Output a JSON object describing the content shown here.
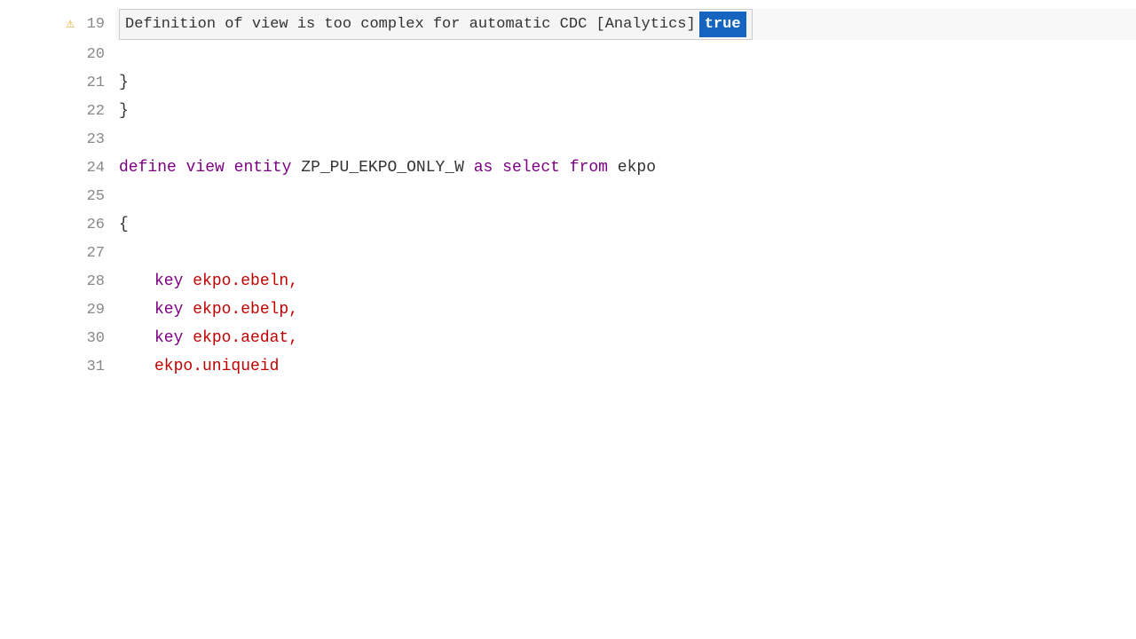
{
  "editor": {
    "lines": [
      {
        "number": "19",
        "hasWarning": true,
        "type": "error-tooltip",
        "tooltip": {
          "message": "Definition of view is too complex for automatic CDC [Analytics]",
          "badge": "true"
        }
      },
      {
        "number": "20",
        "content": ""
      },
      {
        "number": "21",
        "content": "    }"
      },
      {
        "number": "22",
        "content": "  }"
      },
      {
        "number": "23",
        "content": ""
      },
      {
        "number": "24",
        "type": "code",
        "parts": [
          {
            "type": "kw",
            "text": "define"
          },
          {
            "type": "space",
            "text": " "
          },
          {
            "type": "kw",
            "text": "view"
          },
          {
            "type": "space",
            "text": " "
          },
          {
            "type": "kw",
            "text": "entity"
          },
          {
            "type": "space",
            "text": " "
          },
          {
            "type": "plain",
            "text": "ZP_PU_EKPO_ONLY_W "
          },
          {
            "type": "kw",
            "text": "as"
          },
          {
            "type": "space",
            "text": " "
          },
          {
            "type": "kw",
            "text": "select"
          },
          {
            "type": "space",
            "text": " "
          },
          {
            "type": "kw",
            "text": "from"
          },
          {
            "type": "space",
            "text": " "
          },
          {
            "type": "plain",
            "text": "ekpo"
          }
        ]
      },
      {
        "number": "25",
        "content": ""
      },
      {
        "number": "26",
        "content": "    {",
        "type": "brace-line"
      },
      {
        "number": "27",
        "content": ""
      },
      {
        "number": "28",
        "type": "key-line",
        "keyword": "key",
        "field": "ekpo.ebeln,"
      },
      {
        "number": "29",
        "type": "key-line",
        "keyword": "key",
        "field": "ekpo.ebelp,"
      },
      {
        "number": "30",
        "type": "key-line",
        "keyword": "key",
        "field": "ekpo.aedat,"
      },
      {
        "number": "31",
        "type": "partial-line",
        "field": "ekpo.uniqueid"
      }
    ],
    "colors": {
      "keyword": "#7b0082",
      "field": "#c00000",
      "plain": "#333333",
      "lineNumber": "#888888",
      "warning": "#e6a817",
      "tooltipBg": "#f5f5f5",
      "tooltipBorder": "#cccccc",
      "trueBadgeBg": "#1565c0",
      "trueBadgeText": "#ffffff"
    }
  }
}
